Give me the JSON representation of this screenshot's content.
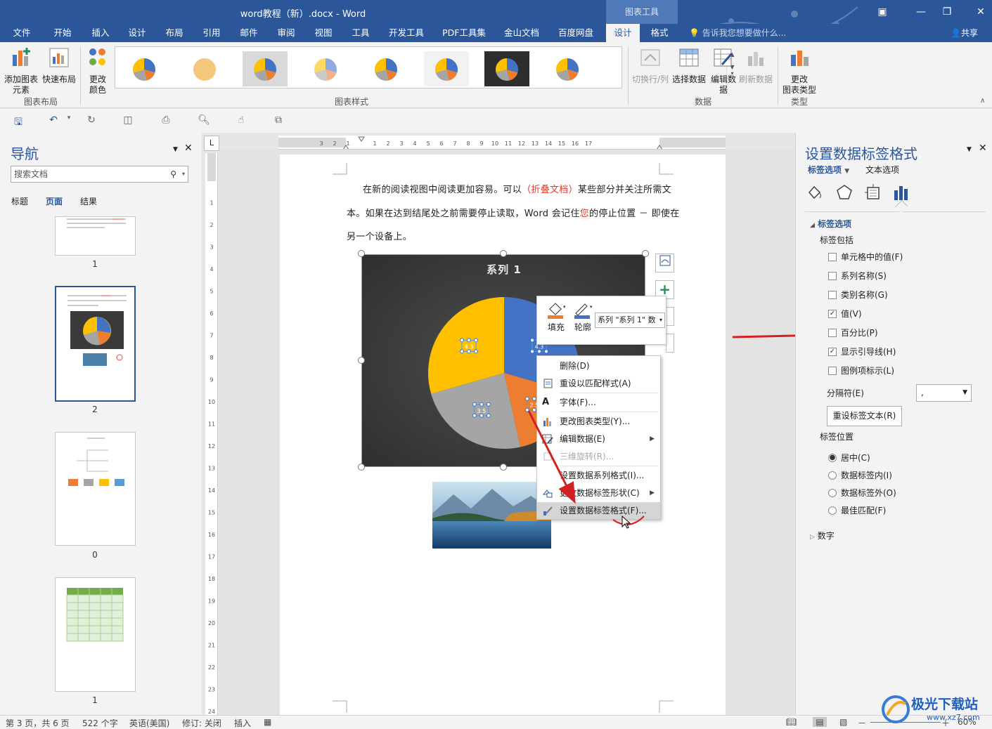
{
  "window": {
    "title": "word教程（新）.docx - Word",
    "context_tab_group": "图表工具",
    "minimize": "—",
    "restore": "❐",
    "close": "✕",
    "ribbon_display": "▣"
  },
  "tabs": [
    "文件",
    "开始",
    "插入",
    "设计",
    "布局",
    "引用",
    "邮件",
    "审阅",
    "视图",
    "工具",
    "开发工具",
    "PDF工具集",
    "金山文档",
    "百度网盘",
    "设计",
    "格式"
  ],
  "active_tab_index": 14,
  "tell_me": "告诉我您想要做什么...",
  "share": "共享",
  "ribbon": {
    "add_element": "添加图表\n元素",
    "quick_layout": "快速布局",
    "group_chart_layout": "图表布局",
    "change_colors": "更改\n颜色",
    "group_chart_styles": "图表样式",
    "switch_row_col": "切换行/列",
    "select_data": "选择数据",
    "edit_data": "编辑数\n据",
    "refresh_data": "刷新数据",
    "group_data": "数据",
    "change_chart_type": "更改\n图表类型",
    "group_type": "类型"
  },
  "nav": {
    "title": "导航",
    "search_placeholder": "搜索文档",
    "tabs": [
      "标题",
      "页面",
      "结果"
    ],
    "page_numbers": [
      "1",
      "2",
      "0",
      "1"
    ]
  },
  "document": {
    "line1_a": "在新的阅读视图中阅读更加容易。可以",
    "line1_red": "（折叠文档）",
    "line1_b": "某些部分并关注所需文",
    "line2_a": "本。如果在达到结尾处之前需要停止读取，Word 会记住",
    "line2_red": "您",
    "line2_b": "的停止位置 － 即使在",
    "line3": "另一个设备上。"
  },
  "chart_data": {
    "type": "pie",
    "title": "系列 1",
    "values": [
      4.3,
      2.5,
      3.5,
      4.3
    ],
    "data_labels": [
      "4.3",
      "2.5",
      "3.5",
      "4.3"
    ],
    "colors": [
      "#4472c4",
      "#ed7d31",
      "#a5a5a5",
      "#ffc000"
    ]
  },
  "mini_toolbar": {
    "fill": "填充",
    "outline": "轮廓",
    "series_select": "系列 \"系列 1\" 数"
  },
  "context_menu": {
    "items": [
      "删除(D)",
      "重设以匹配样式(A)",
      "字体(F)...",
      "更改图表类型(Y)...",
      "编辑数据(E)",
      "三维旋转(R)...",
      "设置数据系列格式(I)...",
      "更改数据标签形状(C)",
      "设置数据标签格式(F)..."
    ]
  },
  "pane": {
    "title": "设置数据标签格式",
    "tab_label_options": "标签选项",
    "tab_text_options": "文本选项",
    "section_label_options": "标签选项",
    "label_contains": "标签包括",
    "checkboxes": [
      {
        "label": "单元格中的值(F)",
        "checked": false
      },
      {
        "label": "系列名称(S)",
        "checked": false
      },
      {
        "label": "类别名称(G)",
        "checked": false
      },
      {
        "label": "值(V)",
        "checked": true
      },
      {
        "label": "百分比(P)",
        "checked": false
      },
      {
        "label": "显示引导线(H)",
        "checked": true
      },
      {
        "label": "图例项标示(L)",
        "checked": false
      }
    ],
    "separator_label": "分隔符(E)",
    "separator_value": ",",
    "reset_button": "重设标签文本(R)",
    "label_position": "标签位置",
    "radios": [
      {
        "label": "居中(C)",
        "checked": true
      },
      {
        "label": "数据标签内(I)",
        "checked": false
      },
      {
        "label": "数据标签外(O)",
        "checked": false
      },
      {
        "label": "最佳匹配(F)",
        "checked": false
      }
    ],
    "section_number": "数字"
  },
  "status": {
    "page": "第 3 页，共 6 页",
    "words": "522 个字",
    "language": "英语(美国)",
    "track": "修订: 关闭",
    "insert": "插入",
    "zoom": "60%"
  },
  "watermark": {
    "name": "极光下载站",
    "url": "www.xz7.com"
  }
}
